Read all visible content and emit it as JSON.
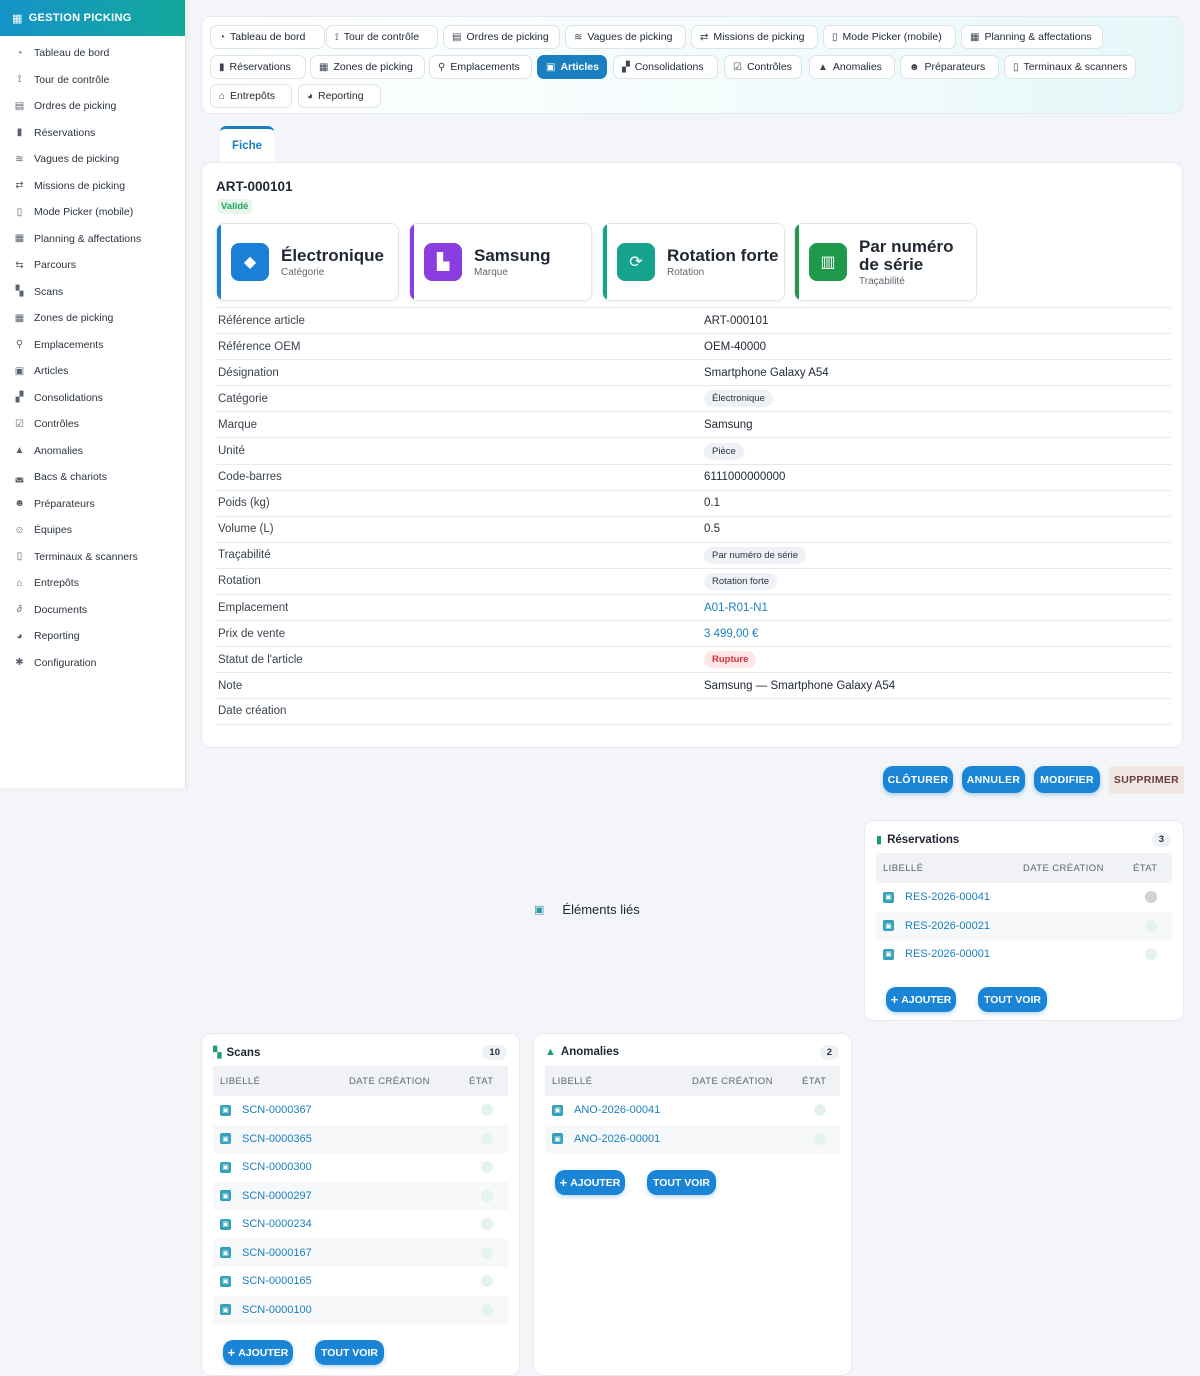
{
  "app": {
    "title": "GESTION PICKING",
    "brand_color": "#1593c9",
    "accent": "#1a7fc0"
  },
  "sidebar": {
    "items": [
      {
        "label": "Tableau de bord",
        "icon": "gauge-icon"
      },
      {
        "label": "Tour de contrôle",
        "icon": "satellite-icon"
      },
      {
        "label": "Ordres de picking",
        "icon": "clipboard-icon"
      },
      {
        "label": "Réservations",
        "icon": "bookmark-icon"
      },
      {
        "label": "Vagues de picking",
        "icon": "layers-icon"
      },
      {
        "label": "Missions de picking",
        "icon": "route-icon"
      },
      {
        "label": "Mode Picker (mobile)",
        "icon": "mobile-icon"
      },
      {
        "label": "Planning & affectations",
        "icon": "calendar-icon"
      },
      {
        "label": "Parcours",
        "icon": "signs-icon"
      },
      {
        "label": "Scans",
        "icon": "qrcode-icon"
      },
      {
        "label": "Zones de picking",
        "icon": "grid-icon"
      },
      {
        "label": "Emplacements",
        "icon": "location-pin-icon"
      },
      {
        "label": "Articles",
        "icon": "box-icon"
      },
      {
        "label": "Consolidations",
        "icon": "boxes-icon"
      },
      {
        "label": "Contrôles",
        "icon": "clipboard-check-icon"
      },
      {
        "label": "Anomalies",
        "icon": "warning-icon"
      },
      {
        "label": "Bacs & chariots",
        "icon": "basket-icon"
      },
      {
        "label": "Préparateurs",
        "icon": "user-gear-icon"
      },
      {
        "label": "Équipes",
        "icon": "users-icon"
      },
      {
        "label": "Terminaux & scanners",
        "icon": "mobile-icon"
      },
      {
        "label": "Entrepôts",
        "icon": "warehouse-icon"
      },
      {
        "label": "Documents",
        "icon": "paperclip-icon"
      },
      {
        "label": "Reporting",
        "icon": "pie-chart-icon"
      },
      {
        "label": "Configuration",
        "icon": "gear-icon"
      }
    ]
  },
  "topnav": {
    "tabs": [
      {
        "label": "Tableau de bord",
        "icon": "gauge-icon"
      },
      {
        "label": "Tour de contrôle",
        "icon": "satellite-icon"
      },
      {
        "label": "Ordres de picking",
        "icon": "clipboard-icon"
      },
      {
        "label": "Vagues de picking",
        "icon": "layers-icon"
      },
      {
        "label": "Missions de picking",
        "icon": "route-icon"
      },
      {
        "label": "Mode Picker (mobile)",
        "icon": "mobile-icon"
      },
      {
        "label": "Planning & affectations",
        "icon": "calendar-icon"
      },
      {
        "label": "Réservations",
        "icon": "bookmark-icon"
      },
      {
        "label": "Zones de picking",
        "icon": "grid-icon"
      },
      {
        "label": "Emplacements",
        "icon": "location-pin-icon"
      },
      {
        "label": "Articles",
        "icon": "box-icon",
        "active": true
      },
      {
        "label": "Consolidations",
        "icon": "boxes-icon"
      },
      {
        "label": "Contrôles",
        "icon": "clipboard-check-icon"
      },
      {
        "label": "Anomalies",
        "icon": "warning-icon"
      },
      {
        "label": "Préparateurs",
        "icon": "user-gear-icon"
      },
      {
        "label": "Terminaux & scanners",
        "icon": "mobile-icon"
      },
      {
        "label": "Entrepôts",
        "icon": "warehouse-icon"
      },
      {
        "label": "Reporting",
        "icon": "pie-chart-icon"
      }
    ]
  },
  "fiche": {
    "tab_label": "Fiche",
    "title": "ART-000101",
    "status": "Validé",
    "cards": [
      {
        "value": "Électronique",
        "label": "Catégorie",
        "icon": "tag-icon",
        "color": "#1a7fd6"
      },
      {
        "value": "Samsung",
        "label": "Marque",
        "icon": "industry-icon",
        "color": "#8b3ee0"
      },
      {
        "value": "Rotation forte",
        "label": "Rotation",
        "icon": "sync-icon",
        "color": "#15a38e"
      },
      {
        "value": "Par numéro de série",
        "label": "Traçabilité",
        "icon": "barcode-icon",
        "color": "#1f9a4a"
      }
    ],
    "fields": [
      {
        "label": "Référence article",
        "value": "ART-000101"
      },
      {
        "label": "Référence OEM",
        "value": "OEM-40000"
      },
      {
        "label": "Désignation",
        "value": "Smartphone Galaxy A54"
      },
      {
        "label": "Catégorie",
        "value": "Électronique",
        "kind": "pill"
      },
      {
        "label": "Marque",
        "value": "Samsung"
      },
      {
        "label": "Unité",
        "value": "Pièce",
        "kind": "pill"
      },
      {
        "label": "Code-barres",
        "value": "6111000000000"
      },
      {
        "label": "Poids (kg)",
        "value": "0.1"
      },
      {
        "label": "Volume (L)",
        "value": "0.5"
      },
      {
        "label": "Traçabilité",
        "value": "Par numéro de série",
        "kind": "pill"
      },
      {
        "label": "Rotation",
        "value": "Rotation forte",
        "kind": "pill"
      },
      {
        "label": "Emplacement",
        "value": "A01-R01-N1",
        "kind": "link"
      },
      {
        "label": "Prix de vente",
        "value": "3 499,00 €",
        "kind": "link"
      },
      {
        "label": "Statut de l'article",
        "value": "Rupture",
        "kind": "pill-red"
      },
      {
        "label": "Note",
        "value": "Samsung — Smartphone Galaxy A54"
      },
      {
        "label": "Date création",
        "value": ""
      }
    ]
  },
  "actions": {
    "cloturer": "CLÔTURER",
    "annuler": "ANNULER",
    "modifier": "MODIFIER",
    "supprimer": "SUPPRIMER"
  },
  "linked": {
    "title": "Éléments liés"
  },
  "panels": {
    "headers": {
      "libelle": "LIBELLÉ",
      "date": "DATE CRÉATION",
      "etat": "ÉTAT"
    },
    "add_label": "AJOUTER",
    "all_label": "TOUT VOIR",
    "reservations": {
      "title": "Réservations",
      "count": "3",
      "icon": "bookmark-icon",
      "rows": [
        "RES-2026-00041",
        "RES-2026-00021",
        "RES-2026-00001"
      ]
    },
    "scans": {
      "title": "Scans",
      "count": "10",
      "icon": "qrcode-icon",
      "rows": [
        "SCN-0000367",
        "SCN-0000365",
        "SCN-0000300",
        "SCN-0000297",
        "SCN-0000234",
        "SCN-0000167",
        "SCN-0000165",
        "SCN-0000100"
      ]
    },
    "anomalies": {
      "title": "Anomalies",
      "count": "2",
      "icon": "warning-icon",
      "rows": [
        "ANO-2026-00041",
        "ANO-2026-00001"
      ]
    }
  }
}
